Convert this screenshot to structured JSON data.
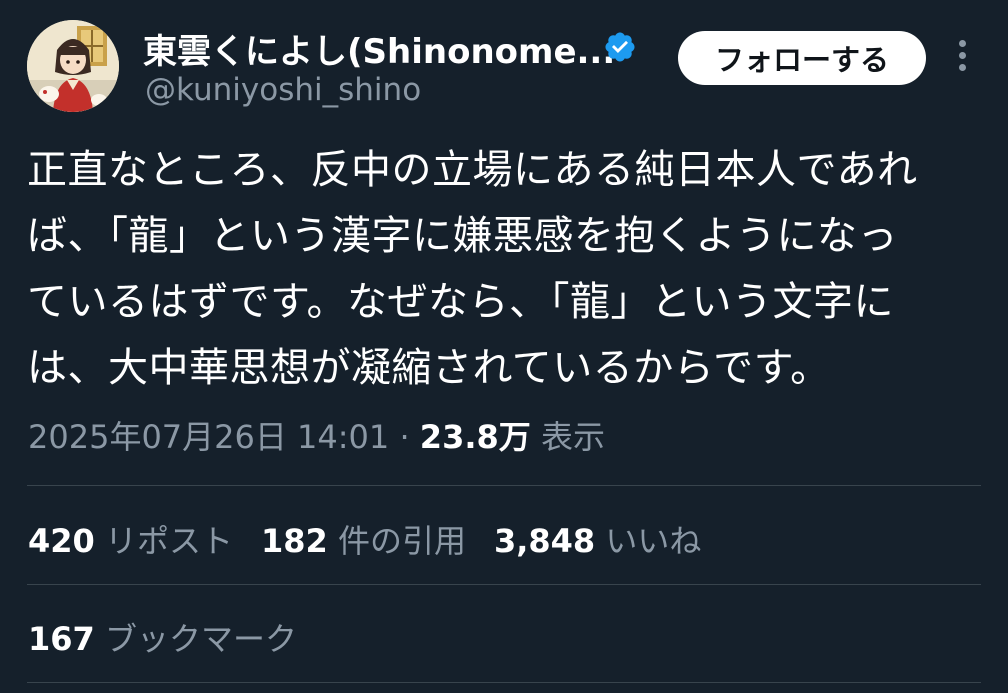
{
  "author": {
    "display_name": "東雲くによし(Shinonome...",
    "handle": "@kuniyoshi_shino",
    "verified": true
  },
  "header": {
    "follow_label": "フォローする",
    "more_icon": "more-vertical-icon"
  },
  "tweet": {
    "lines": [
      "正直なところ、反中の立場にある純日本人であれ",
      "ば、「龍」という漢字に嫌悪感を抱くようになっ",
      "ているはずです。なぜなら、「龍」という文字に",
      "は、大中華思想が凝縮されているからです。"
    ]
  },
  "meta": {
    "timestamp": "2025年07月26日 14:01",
    "separator": "·",
    "views_value": "23.8万",
    "views_label": "表示"
  },
  "stats": {
    "reposts_value": "420",
    "reposts_label": "リポスト",
    "quotes_value": "182",
    "quotes_label": "件の引用",
    "likes_value": "3,848",
    "likes_label": "いいね",
    "bookmarks_value": "167",
    "bookmarks_label": "ブックマーク"
  },
  "colors": {
    "background": "#15202b",
    "secondary_text": "#8b98a5",
    "verified_badge": "#1d9bf0",
    "divider": "#38444d"
  }
}
